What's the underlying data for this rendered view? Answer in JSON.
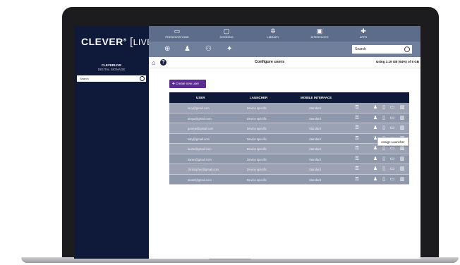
{
  "app": {
    "logo_main": "CLEVER",
    "logo_sup": "®",
    "logo_tail": "LIVE"
  },
  "sidebar": {
    "title": "CLEVERLIVE",
    "subtitle": "DIGITAL SIGNAGE",
    "search_placeholder": "Search"
  },
  "topnav": {
    "items": [
      {
        "label": "PRESENTATIONS",
        "icon": "presentation-icon"
      },
      {
        "label": "SCREENS",
        "icon": "monitor-icon"
      },
      {
        "label": "LIBRARY",
        "icon": "library-icon"
      },
      {
        "label": "INTERFACES",
        "icon": "interfaces-icon"
      },
      {
        "label": "APPS",
        "icon": "apps-icon"
      }
    ]
  },
  "toolbar": {
    "icons": [
      "add-circle-icon",
      "user-icon",
      "users-icon",
      "user-settings-icon"
    ],
    "search_placeholder": "Search"
  },
  "header": {
    "title": "Configure users",
    "usage": "Using 3.19 GB (64%) of 5 GB"
  },
  "create_button": {
    "label": "Create new user"
  },
  "table": {
    "columns": [
      "USER",
      "LAUNCHER",
      "MOBILE INTERFACE"
    ],
    "rows": [
      {
        "user": "lucy@gmail.com",
        "launcher": "Device specific",
        "mobile": "Standard"
      },
      {
        "user": "tanya@gmail.com",
        "launcher": "Device specific",
        "mobile": "Standard"
      },
      {
        "user": "george@gmail.com",
        "launcher": "Device specific",
        "mobile": "Standard"
      },
      {
        "user": "katy@gmail.com",
        "launcher": "Device specific",
        "mobile": "Standard"
      },
      {
        "user": "laurie@gmail.com",
        "launcher": "Device specific",
        "mobile": "Standard"
      },
      {
        "user": "karen@gmail.com",
        "launcher": "Device specific",
        "mobile": "Standard"
      },
      {
        "user": "christopher@gmail.com",
        "launcher": "Device specific",
        "mobile": "Standard"
      },
      {
        "user": "stuart@gmail.com",
        "launcher": "Device specific",
        "mobile": "Standard"
      }
    ],
    "row_action_icons": [
      "unlock-icon",
      "person-icon",
      "mobile-icon",
      "screen-icon",
      "trash-icon"
    ]
  },
  "tooltip": {
    "label": "Assign Launcher"
  },
  "colors": {
    "sidebar": "#0f1a3a",
    "topbar": "#5d6c8a",
    "accent": "#5b2d8e",
    "row": "#8f98ab"
  }
}
